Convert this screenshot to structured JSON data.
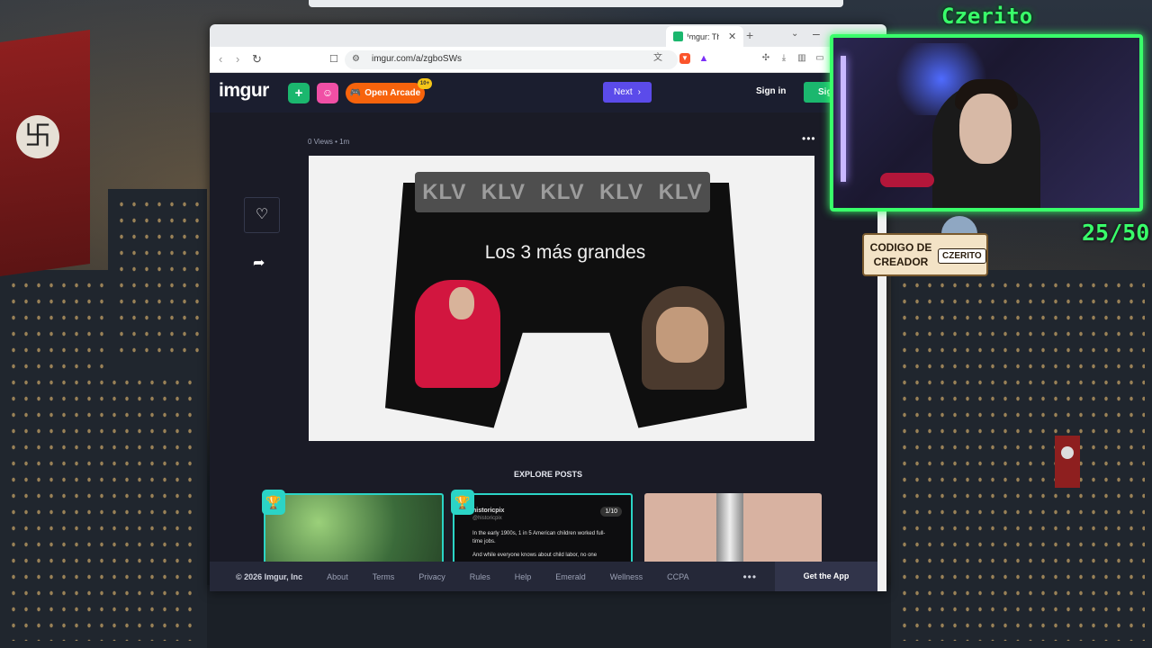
{
  "browser": {
    "tab_title": "Imgur: Th",
    "tab_close": "✕",
    "tab_new": "+",
    "url": "imgur.com/a/zgboSWs"
  },
  "imgur": {
    "logo": "imgur",
    "upload_icon": "+",
    "arcade_label": "Open Arcade",
    "arcade_badge": "10+",
    "next_label": "Next",
    "signin_label": "Sign in",
    "signup_label": "Sig"
  },
  "post": {
    "meta": "0 Views • 1m",
    "image_caption": "Los 3 más grandes",
    "waistband_text": [
      "KLV",
      "KLV",
      "KLV",
      "KLV",
      "KLV"
    ]
  },
  "explore": {
    "heading": "EXPLORE POSTS",
    "card2_user": "historicpix",
    "card2_handle": "@historicpix",
    "card2_count": "1/10",
    "card2_text": "In the early 1900s, 1 in 5 American children worked full-time jobs.",
    "card2_text2": "And while everyone knows about child labor, no one"
  },
  "footer": {
    "copyright": "© 2026 Imgur, Inc",
    "links": [
      "About",
      "Terms",
      "Privacy",
      "Rules",
      "Help",
      "Emerald",
      "Wellness",
      "CCPA"
    ],
    "more": "•••",
    "get_app": "Get the App"
  },
  "stream": {
    "name": "Czerito",
    "counter": "25/50",
    "code_label": "CODIGO DE CREADOR",
    "code_name": "CZERITO"
  },
  "colors": {
    "imgur_bg": "#1b1e2f",
    "next_purple": "#5b4bea",
    "signup_green": "#1bb76e",
    "arcade_orange": "#f7630c",
    "stream_green": "#39ff6a"
  }
}
